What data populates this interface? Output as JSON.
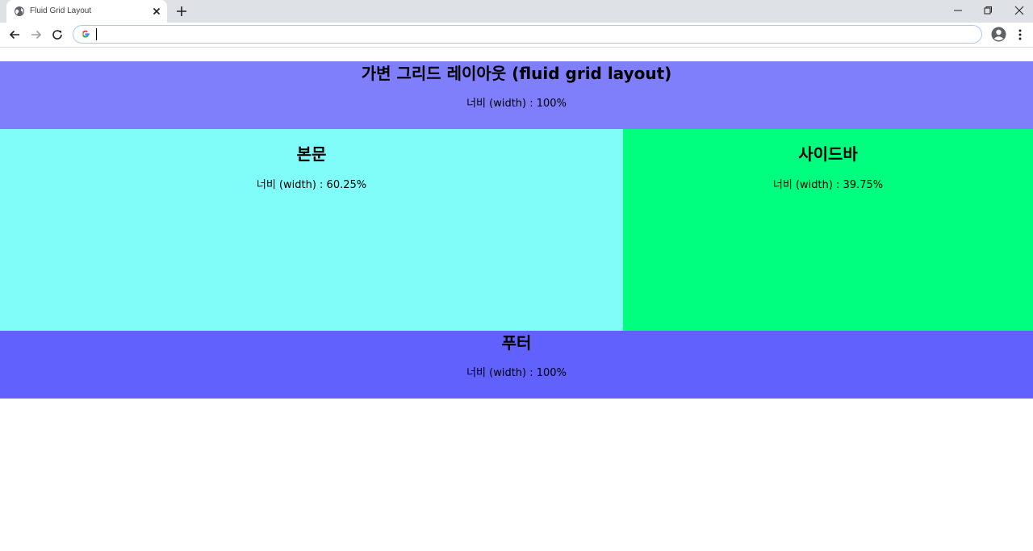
{
  "browser": {
    "tab_title": "Fluid Grid Layout",
    "address_value": "",
    "colors": {
      "tabstrip": "#dee1e6",
      "omnibox_border": "#a8c7fa"
    }
  },
  "page": {
    "header": {
      "title": "가변 그리드 레이아웃 (fluid grid layout)",
      "desc": "너비 (width) : 100%",
      "color": "#7f7ffc"
    },
    "main": {
      "title": "본문",
      "desc": "너비 (width) : 60.25%",
      "color": "#80fcf9"
    },
    "sidebar": {
      "title": "사이드바",
      "desc": "너비 (width) : 39.75%",
      "color": "#00ff7f"
    },
    "footer": {
      "title": "푸터",
      "desc": "너비 (width) : 100%",
      "color": "#6161fe"
    }
  }
}
